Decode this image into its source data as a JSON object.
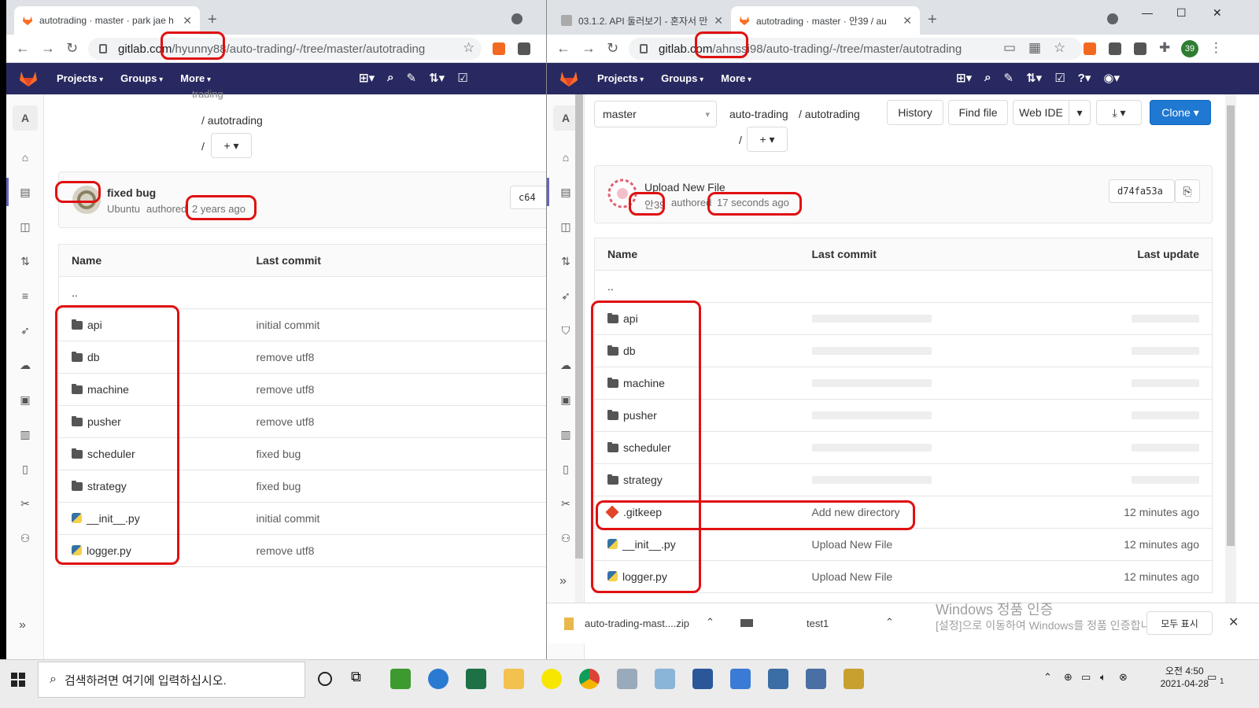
{
  "left": {
    "tab_title": "autotrading · master · park jae h",
    "url_host": "gitlab.com",
    "url_user": "/hyunny88",
    "url_rest": "/auto-trading/-/tree/master/autotrading",
    "nav": [
      "Projects",
      "Groups",
      "More"
    ],
    "crumb_partial": "trading",
    "crumb_dir": "/ autotrading",
    "crumb_slash": "/",
    "commit": {
      "title": "fixed bug",
      "author": "Ubuntu",
      "authored": "authored",
      "time": "2 years ago",
      "sha_partial": "c64"
    },
    "table": {
      "headers": [
        "Name",
        "Last commit"
      ],
      "parent": "..",
      "rows": [
        {
          "name": "api",
          "type": "folder",
          "commit": "initial commit"
        },
        {
          "name": "db",
          "type": "folder",
          "commit": "remove utf8"
        },
        {
          "name": "machine",
          "type": "folder",
          "commit": "remove utf8"
        },
        {
          "name": "pusher",
          "type": "folder",
          "commit": "remove utf8"
        },
        {
          "name": "scheduler",
          "type": "folder",
          "commit": "fixed bug"
        },
        {
          "name": "strategy",
          "type": "folder",
          "commit": "fixed bug"
        },
        {
          "name": "__init__.py",
          "type": "python",
          "commit": "initial commit"
        },
        {
          "name": "logger.py",
          "type": "python",
          "commit": "remove utf8"
        }
      ]
    }
  },
  "right": {
    "tab1_title": "03.1.2. API 둘러보기 - 혼자서 만",
    "tab2_title": "autotrading · master · 안39 / au",
    "url_host": "gitlab.com",
    "url_user": "/ahnssi98",
    "url_rest": "/auto-trading/-/tree/master/autotrading",
    "profile_badge": "39",
    "nav": [
      "Projects",
      "Groups",
      "More"
    ],
    "branch": "master",
    "crumb_project": "auto-trading",
    "crumb_dir": "/ autotrading",
    "crumb_slash": "/",
    "buttons": {
      "history": "History",
      "find_file": "Find file",
      "web_ide": "Web IDE",
      "clone": "Clone"
    },
    "commit": {
      "title": "Upload New File",
      "author": "안39",
      "authored": "authored",
      "time": "17 seconds ago",
      "sha": "d74fa53a"
    },
    "table": {
      "headers": [
        "Name",
        "Last commit",
        "Last update"
      ],
      "parent": "..",
      "rows": [
        {
          "name": "api",
          "type": "folder",
          "commit": "",
          "update": ""
        },
        {
          "name": "db",
          "type": "folder",
          "commit": "",
          "update": ""
        },
        {
          "name": "machine",
          "type": "folder",
          "commit": "",
          "update": ""
        },
        {
          "name": "pusher",
          "type": "folder",
          "commit": "",
          "update": ""
        },
        {
          "name": "scheduler",
          "type": "folder",
          "commit": "",
          "update": ""
        },
        {
          "name": "strategy",
          "type": "folder",
          "commit": "",
          "update": ""
        },
        {
          "name": ".gitkeep",
          "type": "git",
          "commit": "Add new directory",
          "update": "12 minutes ago"
        },
        {
          "name": "__init__.py",
          "type": "python",
          "commit": "Upload New File",
          "update": "12 minutes ago"
        },
        {
          "name": "logger.py",
          "type": "python",
          "commit": "Upload New File",
          "update": "12 minutes ago"
        }
      ]
    },
    "downloads": [
      {
        "name": "auto-trading-mast....zip"
      },
      {
        "name": "test1"
      }
    ],
    "show_all": "모두 표시",
    "watermark_title": "Windows 정품 인증",
    "watermark_sub": "[설정]으로 이동하여 Windows를 정품 인증합니다."
  },
  "taskbar": {
    "search_placeholder": "검색하려면 여기에 입력하십시오.",
    "time": "오전 4:50",
    "date": "2021-04-28",
    "notification_count": "1"
  },
  "colors": {
    "gitlab_nav": "#292961",
    "highlight": "#e01010",
    "clone_blue": "#1f78d1"
  }
}
